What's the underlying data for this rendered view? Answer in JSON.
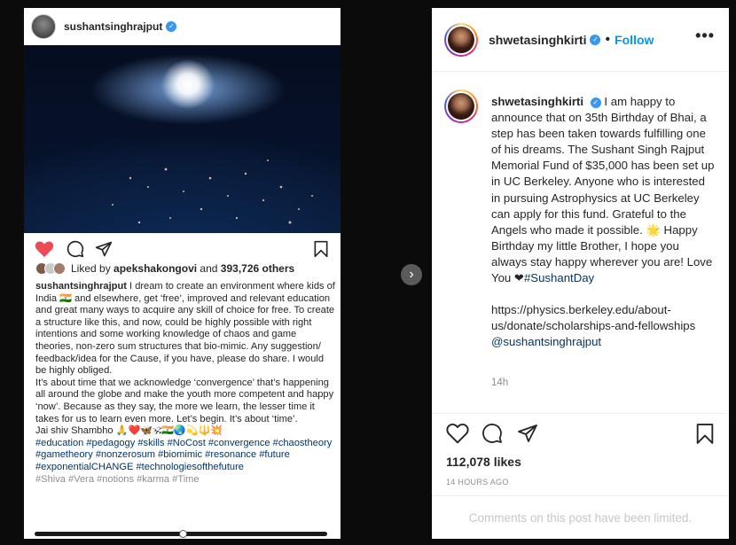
{
  "left_post": {
    "username": "sushantsinghrajput",
    "liked_by_prefix": "Liked by",
    "liked_by_user": "apekshakongovi",
    "liked_by_and": "and",
    "liked_by_count": "393,726 others",
    "caption_user": "sushantsinghrajput",
    "caption_p1": "I dream to create an environment where kids of India 🇮🇳 and elsewhere, get ‘free’, improved and relevant education and great many ways to acquire any skill of choice for free. To create a structure like this, and now, could be highly possible with right intentions and some working knowledge of chaos and game theories, non-zero sum structures that bio-mimic. Any suggestion/ feedback/idea for the Cause, if you have, please do share. I would be highly obliged.",
    "caption_p2": "It’s about time that we acknowledge ‘convergence’ that’s happening all around the globe and make the youth more competent and happy ‘now’. Because as they say, the more we learn, the lesser time it takes for us to learn even more. Let’s begin. It’s about ‘time’.",
    "caption_p3": "Jai shiv Shambho 🙏❤️🦋🕉🇮🇳🌏💫🔱💥",
    "hashtags": "#education #pedagogy #skills #NoCost #convergence #chaostheory #gametheory #nonzerosum #biomimic #resonance #future #exponentialCHANGE #technologiesofthefuture",
    "hashtags_cut": "#Shiva #Vera #notions #karma #Time"
  },
  "right_post": {
    "username": "shwetasinghkirti",
    "dot": "•",
    "follow": "Follow",
    "caption_user": "shwetasinghkirti",
    "caption_text": "I am happy to announce that on 35th Birthday of Bhai, a step has been taken towards fulfilling one of his dreams. The Sushant Singh Rajput Memorial Fund of $35,000 has been set up in UC Berkeley. Anyone who is interested in pursuing Astrophysics at UC Berkeley can apply for this fund. Grateful to the Angels who made it possible. 🌟 Happy Birthday my little Brother, I hope you always stay happy wherever you are! Love You ❤",
    "caption_tag": "#SushantDay",
    "link_text": "https://physics.berkeley.edu/about-us/donate/scholarships-and-fellowships",
    "mention": "@sushantsinghrajput",
    "time_ago_short": "14h",
    "likes": "112,078 likes",
    "time_ago_long": "14 HOURS AGO",
    "comments_notice": "Comments on this post have been limited."
  },
  "icons": {
    "heart": "heart-icon",
    "comment": "comment-icon",
    "share": "share-icon",
    "save": "bookmark-icon",
    "more": "more-icon",
    "next": "chevron-right-icon",
    "verified": "verified-badge-icon"
  },
  "colors": {
    "accent": "#0095f6",
    "liked_heart": "#ed4956",
    "hashtag": "#00376b",
    "muted": "#8e8e8e"
  }
}
